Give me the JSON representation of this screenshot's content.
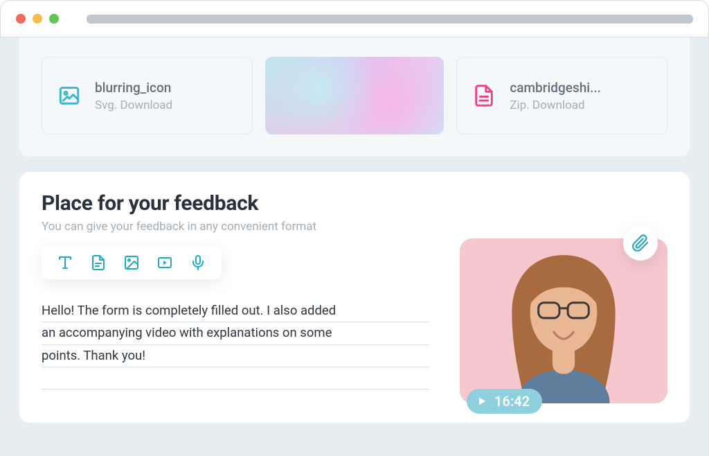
{
  "attachments": {
    "items": [
      {
        "name": "blurring_icon",
        "sub": "Svg. Download",
        "icon": "image"
      },
      {
        "thumb": true
      },
      {
        "name": "cambridgeshi...",
        "sub": "Zip. Download",
        "icon": "file",
        "pink": true
      }
    ]
  },
  "feedback": {
    "title": "Place for your feedback",
    "subtitle": "You can give your feedback in any convenient format",
    "text_lines": [
      "Hello! The form is completely filled out. I also added",
      "an accompanying video with explanations on some",
      "points. Thank you!",
      ""
    ]
  },
  "video": {
    "duration": "16:42"
  },
  "toolbar_tools": [
    "text",
    "file",
    "image",
    "video",
    "mic"
  ]
}
